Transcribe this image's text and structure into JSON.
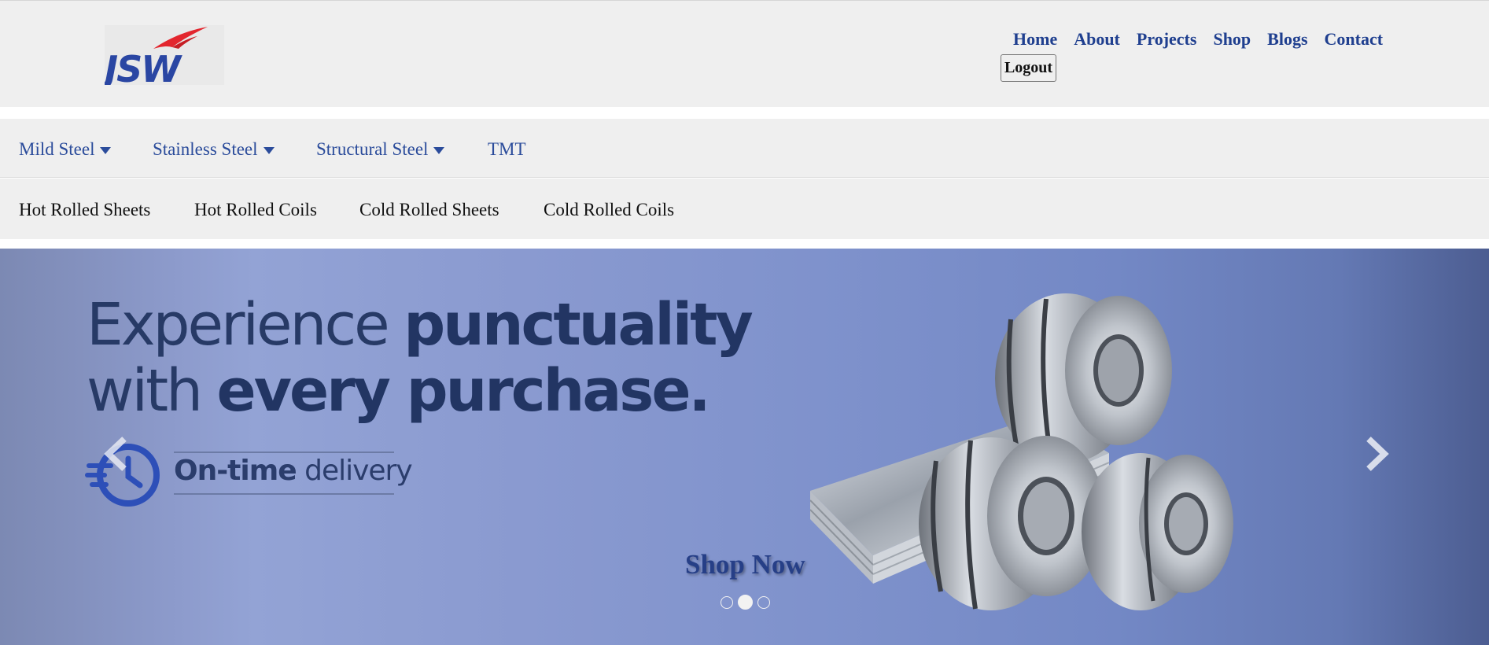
{
  "header": {
    "logo_text": "JSW",
    "nav": [
      {
        "label": "Home"
      },
      {
        "label": "About"
      },
      {
        "label": "Projects"
      },
      {
        "label": "Shop"
      },
      {
        "label": "Blogs"
      },
      {
        "label": "Contact"
      }
    ],
    "logout_label": "Logout"
  },
  "categories": [
    {
      "label": "Mild Steel",
      "has_dropdown": true
    },
    {
      "label": "Stainless Steel",
      "has_dropdown": true
    },
    {
      "label": "Structural Steel",
      "has_dropdown": true
    },
    {
      "label": "TMT",
      "has_dropdown": false
    }
  ],
  "subcategories": [
    {
      "label": "Hot Rolled Sheets"
    },
    {
      "label": "Hot Rolled Coils"
    },
    {
      "label": "Cold Rolled Sheets"
    },
    {
      "label": "Cold Rolled Coils"
    }
  ],
  "hero": {
    "line1_regular": "Experience ",
    "line1_bold": "punctuality",
    "line2_regular": "with ",
    "line2_bold": "every purchase.",
    "delivery_bold": "On-time",
    "delivery_regular": " delivery",
    "cta_label": "Shop Now",
    "prev_icon": "chevron-left-icon",
    "next_icon": "chevron-right-icon",
    "slides_total": 3,
    "active_slide": 2
  },
  "colors": {
    "brand_blue": "#1f3f8f",
    "logo_red": "#e3262e",
    "header_bg": "#efefef"
  }
}
